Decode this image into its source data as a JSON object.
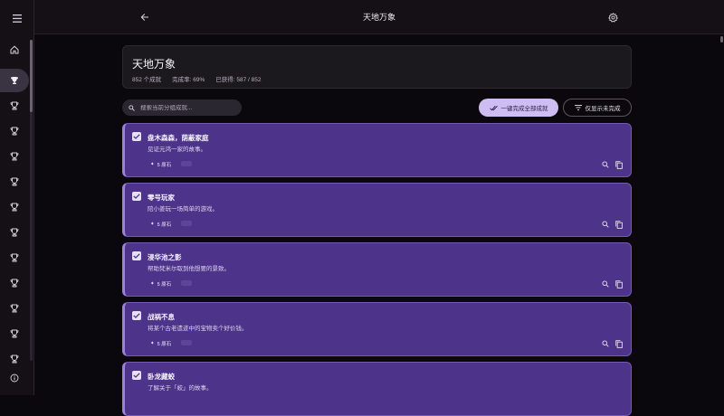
{
  "app": {
    "title": "天地万象"
  },
  "header": {
    "title": "天地万象",
    "total": "852 个成就",
    "rate": "完成率: 69%",
    "obtained": "已获得: 587 / 852"
  },
  "search": {
    "placeholder": "搜索当前分组成就..."
  },
  "actions": {
    "complete_all": "一键完成全部成就",
    "only_incomplete": "仅显示未完成"
  },
  "achievements": [
    {
      "name": "盘木森森，荫蔽家庭",
      "desc": "见证元鸿一家的故事。",
      "reward": "5 原石",
      "checked": true
    },
    {
      "name": "零号玩家",
      "desc": "陪小姜玩一场简单的游戏。",
      "reward": "5 原石",
      "checked": true
    },
    {
      "name": "浸华池之影",
      "desc": "帮助梵米尔取到他想要的景致。",
      "reward": "5 原石",
      "checked": true
    },
    {
      "name": "战祸不息",
      "desc": "将某个古老遗迹中的宝物卖个好价钱。",
      "reward": "5 原石",
      "checked": true
    },
    {
      "name": "卧龙藏蛟",
      "desc": "了解关于「蛟」的故事。",
      "reward": "5 原石",
      "checked": true
    }
  ],
  "icons": {
    "menu": "menu-icon",
    "back": "arrow-back-icon",
    "settings": "gear-icon",
    "home": "home-icon",
    "trophy": "trophy-icon",
    "info": "info-icon"
  },
  "colors": {
    "card_bg": "#4e338a",
    "card_border": "#7659b2",
    "primary_button": "#cdbdf2",
    "background": "#0b080d"
  }
}
